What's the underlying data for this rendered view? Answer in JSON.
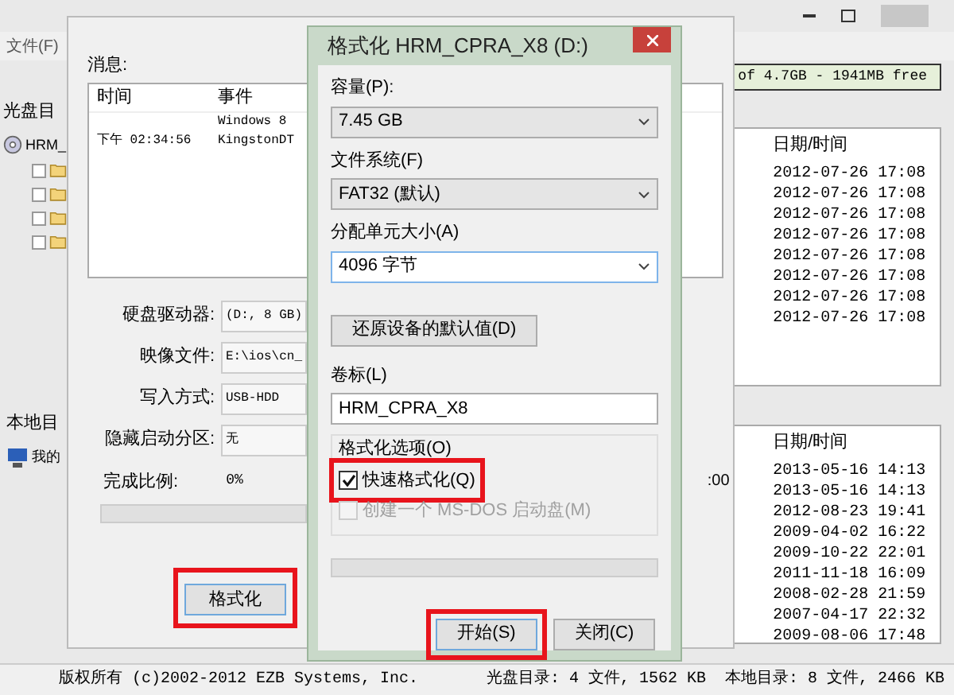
{
  "main_window": {
    "menu": [
      "文件(F)"
    ],
    "space_info": "of 4.7GB - 1941MB free",
    "iso_panel": {
      "title": "光盘目",
      "tree": [
        {
          "label": "HRM_",
          "kind": "disc",
          "children": [
            {
              "kind": "folder"
            },
            {
              "kind": "folder"
            },
            {
              "kind": "folder"
            },
            {
              "kind": "folder"
            }
          ]
        }
      ]
    },
    "iso_list": {
      "column": "日期/时间",
      "rows": [
        "2012-07-26 17:08",
        "2012-07-26 17:08",
        "2012-07-26 17:08",
        "2012-07-26 17:08",
        "2012-07-26 17:08",
        "2012-07-26 17:08",
        "2012-07-26 17:08",
        "2012-07-26 17:08"
      ]
    },
    "local_panel": {
      "title": "本地目",
      "tree": [
        {
          "label": "我的",
          "kind": "computer"
        }
      ]
    },
    "local_list": {
      "column": "日期/时间",
      "rows": [
        "2013-05-16 14:13",
        "2013-05-16 14:13",
        "2012-08-23 19:41",
        "2009-04-02 16:22",
        "2009-10-22 22:01",
        "2011-11-18 16:09",
        "2008-02-28 21:59",
        "2007-04-17 22:32",
        "2009-08-06 17:48"
      ]
    },
    "status_bar": [
      "版权所有 (c)2002-2012 EZB Systems, Inc.",
      "光盘目录: 4 文件, 1562 KB",
      "本地目录: 8 文件, 2466 KB"
    ]
  },
  "write_dialog": {
    "messages_label": "消息:",
    "columns": [
      "时间",
      "事件"
    ],
    "messages": [
      {
        "event": "Windows 8"
      },
      {
        "time": "下午 02:34:56",
        "event": "KingstonDT"
      }
    ],
    "fields": [
      {
        "label": "硬盘驱动器:",
        "value": "(D:, 8 GB)"
      },
      {
        "label": "映像文件:",
        "value": "E:\\ios\\cn_"
      },
      {
        "label": "写入方式:",
        "value": "USB-HDD"
      },
      {
        "label": "隐藏启动分区:",
        "value": "无"
      }
    ],
    "progress_label": "完成比例:",
    "progress_value": "0%",
    "progress": {
      "level": 0
    },
    "time_fragment": ":00",
    "format_button": {
      "label": "格式化",
      "highlighted": true
    }
  },
  "format_dialog": {
    "title": "格式化 HRM_CPRA_X8 (D:)",
    "capacity": {
      "label": "容量(P):",
      "value": "7.45 GB"
    },
    "filesystem": {
      "label": "文件系统(F)",
      "value": "FAT32 (默认)"
    },
    "cluster": {
      "label": "分配单元大小(A)",
      "value": "4096 字节"
    },
    "restore_button": "还原设备的默认值(D)",
    "volume": {
      "label": "卷标(L)",
      "value": "HRM_CPRA_X8"
    },
    "options_label": "格式化选项(O)",
    "options": [
      {
        "label": "快速格式化(Q)",
        "checked": true,
        "disabled": false,
        "highlighted": true
      },
      {
        "label": "创建一个 MS-DOS 启动盘(M)",
        "checked": false,
        "disabled": true,
        "highlighted": false
      }
    ],
    "progress": {
      "level": 0
    },
    "buttons": [
      {
        "label": "开始(S)",
        "highlighted": true
      },
      {
        "label": "关闭(C)",
        "highlighted": false
      }
    ]
  }
}
